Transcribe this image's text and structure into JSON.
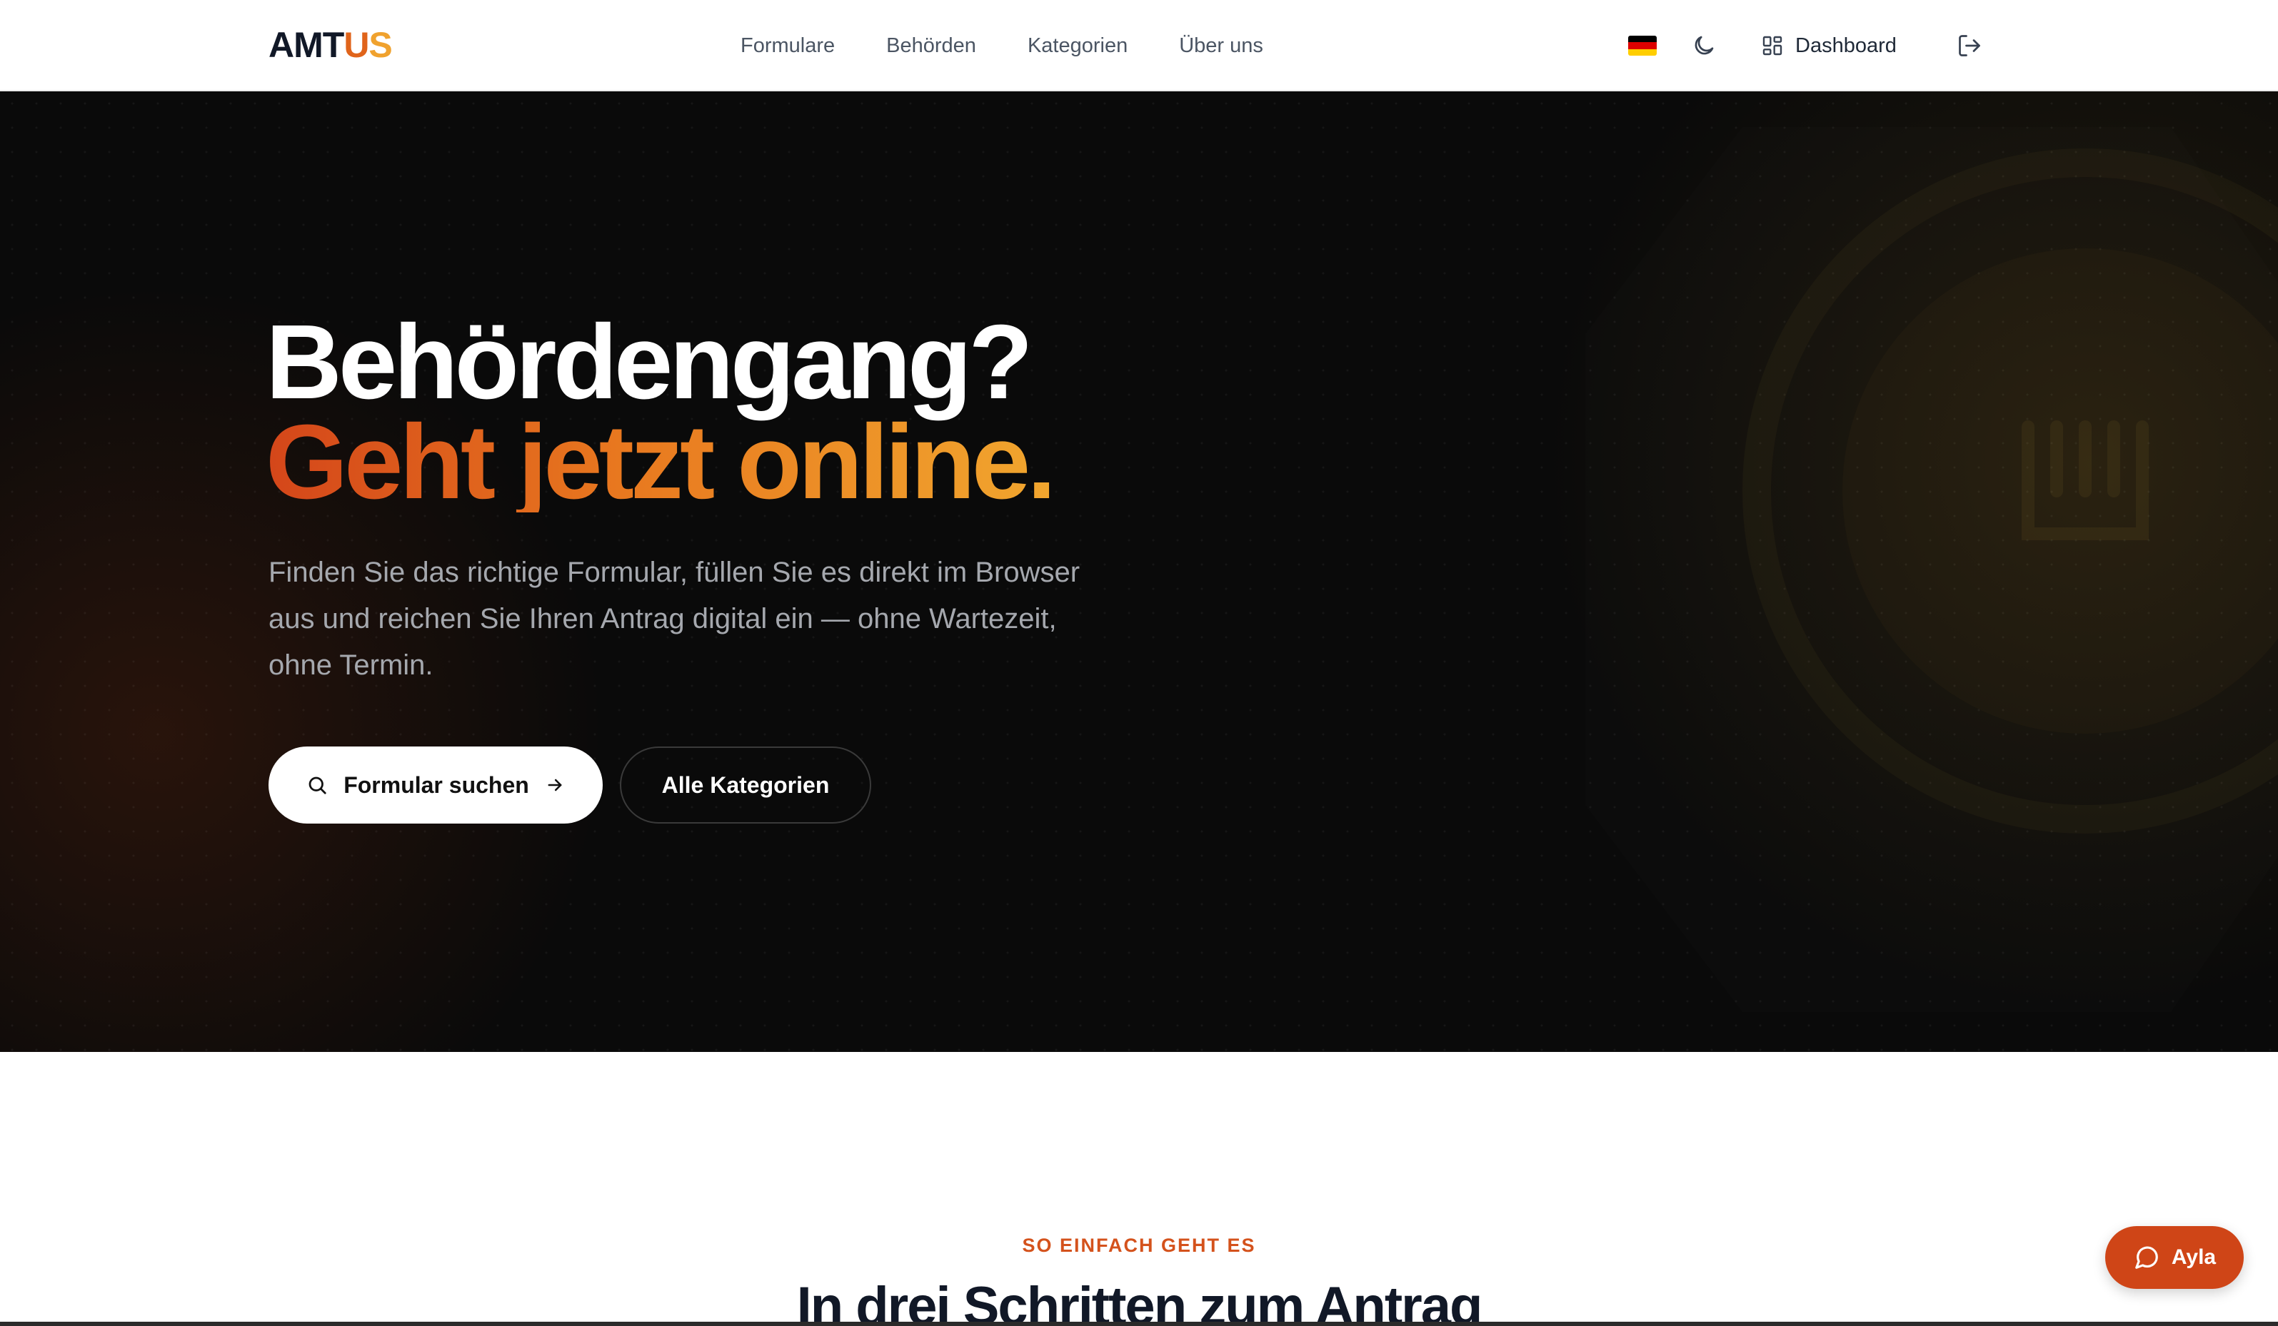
{
  "brand": {
    "logo_part1": "AMT",
    "logo_part2": "U",
    "logo_part3": "S"
  },
  "nav": {
    "items": [
      {
        "label": "Formulare"
      },
      {
        "label": "Behörden"
      },
      {
        "label": "Kategorien"
      },
      {
        "label": "Über uns"
      }
    ]
  },
  "header_actions": {
    "language_flag_icon": "germany-flag-icon",
    "theme_icon": "moon-icon",
    "dashboard_icon": "grid-icon",
    "dashboard_label": "Dashboard",
    "logout_icon": "logout-icon"
  },
  "hero": {
    "headline_line1": "Behördengang?",
    "headline_line2": "Geht jetzt online.",
    "subtext": "Finden Sie das richtige Formular, füllen Sie es direkt im Browser aus und reichen Sie Ihren Antrag digital ein — ohne Wartezeit, ohne Termin.",
    "primary_button_label": "Formular suchen",
    "primary_button_icon": "search-icon",
    "primary_button_trailing_icon": "arrow-right-icon",
    "secondary_button_label": "Alle Kategorien"
  },
  "steps_section": {
    "eyebrow": "SO EINFACH GEHT ES",
    "title": "In drei Schritten zum Antrag"
  },
  "chat": {
    "label": "Ayla",
    "icon": "chat-bubble-icon"
  },
  "colors": {
    "accent_orange": "#e0641b",
    "accent_yellow": "#f0a22e",
    "accent_red": "#cf4517",
    "hero_background": "#0a0a0a",
    "text_dark": "#111827"
  }
}
